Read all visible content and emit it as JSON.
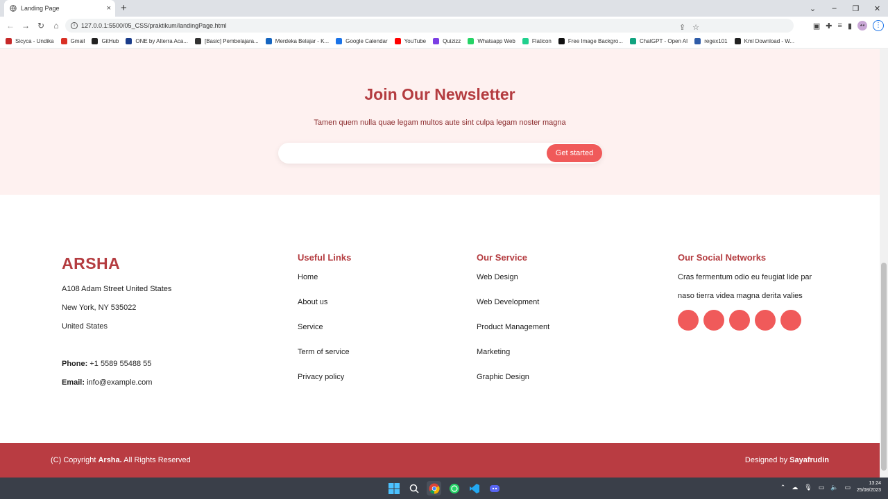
{
  "browser": {
    "tab_title": "Landing Page",
    "tab_close": "×",
    "new_tab": "+",
    "url": "127.0.0.1:5500/05_CSS/praktikum/landingPage.html",
    "window_controls": [
      "⌄",
      "–",
      "❐",
      "✕"
    ],
    "bookmarks": [
      {
        "label": "Sicyca - Undika",
        "color": "#c62828"
      },
      {
        "label": "Gmail",
        "color": "#d93025"
      },
      {
        "label": "GitHub",
        "color": "#222222"
      },
      {
        "label": "ONE by Alterra Aca...",
        "color": "#1a3c8a"
      },
      {
        "label": "[Basic] Pembelajara...",
        "color": "#333333"
      },
      {
        "label": "Merdeka Belajar - K...",
        "color": "#1565c0"
      },
      {
        "label": "Google Calendar",
        "color": "#1a73e8"
      },
      {
        "label": "YouTube",
        "color": "#ff0000"
      },
      {
        "label": "Quizizz",
        "color": "#7b3fe4"
      },
      {
        "label": "Whatsapp Web",
        "color": "#25d366"
      },
      {
        "label": "Flaticon",
        "color": "#21d08e"
      },
      {
        "label": "Free Image Backgro...",
        "color": "#111111"
      },
      {
        "label": "ChatGPT - Open AI",
        "color": "#10a37f"
      },
      {
        "label": "regex101",
        "color": "#2f5ca8"
      },
      {
        "label": "Kml Download - W...",
        "color": "#222222"
      }
    ]
  },
  "newsletter": {
    "title": "Join Our Newsletter",
    "subtitle": "Tamen quem nulla quae legam multos aute sint culpa legam noster magna",
    "input_value": "",
    "button_label": "Get started"
  },
  "footer": {
    "brand": "ARSHA",
    "address": [
      "A108 Adam Street United States",
      "New York, NY 535022",
      "United States"
    ],
    "phone_label": "Phone:",
    "phone": "+1 5589 55488 55",
    "email_label": "Email:",
    "email": "info@example.com",
    "useful_links": {
      "title": "Useful Links",
      "items": [
        "Home",
        "About us",
        "Service",
        "Term of service",
        "Privacy policy"
      ]
    },
    "services": {
      "title": "Our Service",
      "items": [
        "Web Design",
        "Web Development",
        "Product Management",
        "Marketing",
        "Graphic Design"
      ]
    },
    "social": {
      "title": "Our Social Networks",
      "text": "Cras fermentum odio eu feugiat lide par naso tierra videa magna derita valies",
      "icons": [
        "social-icon-1",
        "social-icon-2",
        "social-icon-3",
        "social-icon-4",
        "social-icon-5"
      ]
    },
    "copyright_prefix": "(C) Copyright",
    "copyright_brand": "Arsha.",
    "copyright_suffix": "All Rights Reserved",
    "designed_prefix": "Designed by",
    "designed_by": "Sayafrudin"
  },
  "taskbar": {
    "time": "13:24",
    "date": "25/08/2023"
  }
}
